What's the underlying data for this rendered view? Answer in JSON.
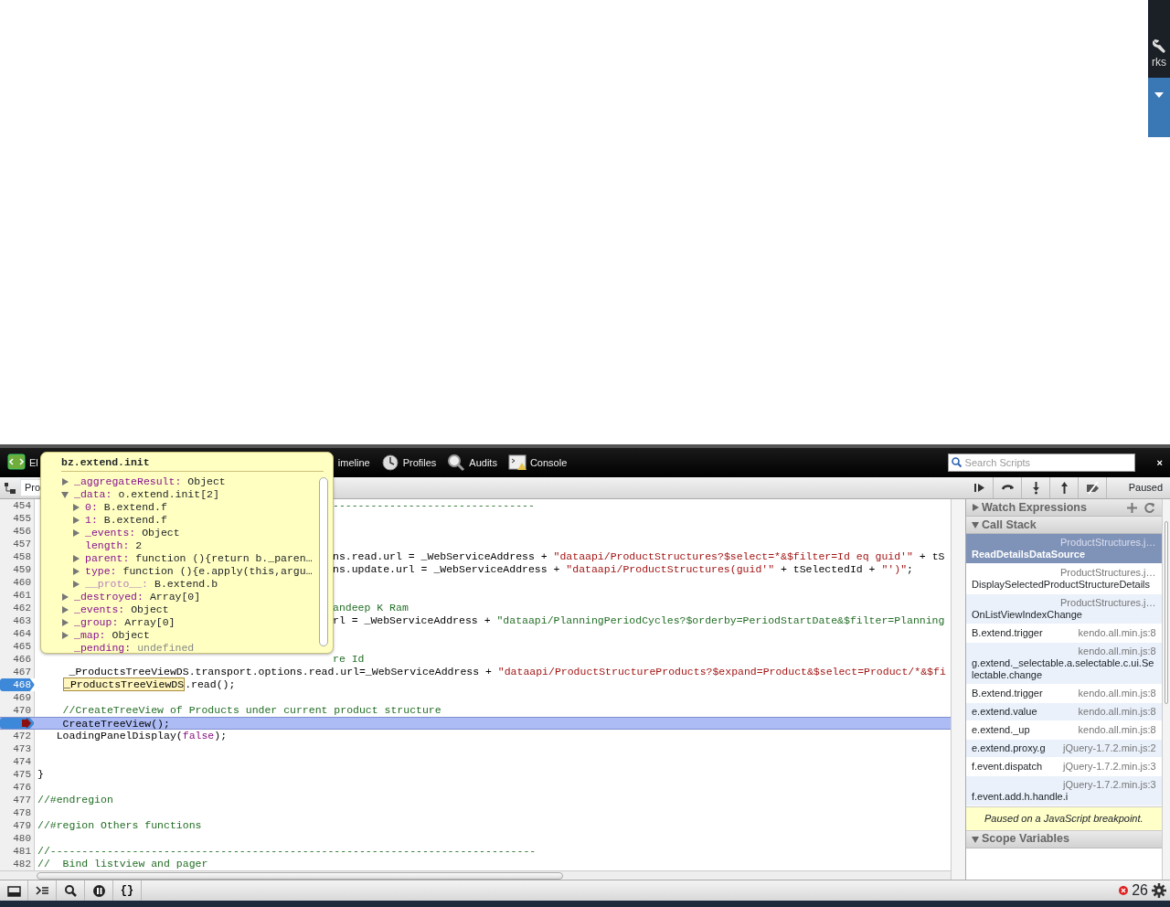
{
  "browser_edge": {
    "label": "rks"
  },
  "devtools": {
    "tabs": [
      {
        "label": "El"
      },
      {
        "label": "imeline"
      },
      {
        "label": "Profiles"
      },
      {
        "label": "Audits"
      },
      {
        "label": "Console"
      }
    ],
    "search": {
      "placeholder": "Search Scripts"
    },
    "close": "×",
    "script_select": "Pro",
    "status": "Paused",
    "code_lines": [
      {
        "number": "454",
        "kind": "behind_tooltip",
        "breakpoint": false,
        "current": false,
        "segments": [
          {
            "text": "--------------------------------",
            "kind": "comment"
          }
        ]
      },
      {
        "number": "455",
        "breakpoint": false,
        "current": false
      },
      {
        "number": "456",
        "breakpoint": false,
        "current": false
      },
      {
        "number": "457",
        "breakpoint": false,
        "current": false
      },
      {
        "number": "458",
        "kind": "behind_tooltip",
        "breakpoint": false,
        "current": false,
        "segments": [
          {
            "text": "ns.read.url = _WebServiceAddress + ",
            "kind": "plain"
          },
          {
            "text": "\"dataapi/ProductStructures?$select=*&$filter=Id eq guid'\"",
            "kind": "string"
          },
          {
            "text": " + tS",
            "kind": "plain"
          }
        ]
      },
      {
        "number": "459",
        "kind": "behind_tooltip",
        "breakpoint": false,
        "current": false,
        "segments": [
          {
            "text": "ns.update.url = _WebServiceAddress + ",
            "kind": "plain"
          },
          {
            "text": "\"dataapi/ProductStructures(guid'\"",
            "kind": "string"
          },
          {
            "text": " + tSelectedId + ",
            "kind": "plain"
          },
          {
            "text": "\"')\"",
            "kind": "string"
          },
          {
            "text": ";",
            "kind": "plain"
          }
        ]
      },
      {
        "number": "460",
        "breakpoint": false,
        "current": false
      },
      {
        "number": "461",
        "breakpoint": false,
        "current": false
      },
      {
        "number": "462",
        "kind": "behind_tooltip",
        "breakpoint": false,
        "current": false,
        "segments": [
          {
            "text": "andeep K Ram",
            "kind": "comment"
          }
        ]
      },
      {
        "number": "463",
        "kind": "behind_tooltip",
        "breakpoint": false,
        "current": false,
        "segments": [
          {
            "text": "rl = _WebServiceAddress + ",
            "kind": "plain"
          },
          {
            "text": "\"dataapi/PlanningPeriodCycles?$orderby=PeriodStartDate&$filter=Planning",
            "kind": "string_alt"
          }
        ]
      },
      {
        "number": "464",
        "breakpoint": false,
        "current": false
      },
      {
        "number": "465",
        "breakpoint": false,
        "current": false
      },
      {
        "number": "466",
        "kind": "behind_tooltip",
        "breakpoint": false,
        "current": false,
        "segments": [
          {
            "text": "re Id",
            "kind": "comment"
          }
        ]
      },
      {
        "number": "467",
        "kind": "full",
        "breakpoint": false,
        "current": false,
        "segments": [
          {
            "text": "     _ProductsTreeViewDS.transport.options.read.url=_WebServiceAddress + ",
            "kind": "plain"
          },
          {
            "text": "\"dataapi/ProductStructureProducts?$expand=Product&$select=Product/*&$fi",
            "kind": "string"
          }
        ]
      },
      {
        "number": "468",
        "kind": "full",
        "breakpoint": true,
        "current": false,
        "segments": [
          {
            "text": "_ProductsTreeViewDS",
            "kind": "hover"
          },
          {
            "text": ".read();",
            "kind": "plain"
          }
        ]
      },
      {
        "number": "469",
        "breakpoint": false,
        "current": false
      },
      {
        "number": "470",
        "kind": "full",
        "breakpoint": false,
        "current": false,
        "segments": [
          {
            "text": "    //CreateTreeView of Products under current product structure",
            "kind": "comment"
          }
        ]
      },
      {
        "kind": "full",
        "breakpoint": true,
        "current": true,
        "segments": [
          {
            "text": "    CreateTreeView();",
            "kind": "plain"
          }
        ]
      },
      {
        "number": "472",
        "kind": "full",
        "breakpoint": false,
        "current": false,
        "segments": [
          {
            "text": "   LoadingPanelDisplay(",
            "kind": "plain"
          },
          {
            "text": "false",
            "kind": "keyword"
          },
          {
            "text": ");",
            "kind": "plain"
          }
        ]
      },
      {
        "number": "473",
        "breakpoint": false,
        "current": false
      },
      {
        "number": "474",
        "breakpoint": false,
        "current": false
      },
      {
        "number": "475",
        "kind": "full",
        "breakpoint": false,
        "current": false,
        "segments": [
          {
            "text": "}",
            "kind": "plain"
          }
        ]
      },
      {
        "number": "476",
        "breakpoint": false,
        "current": false
      },
      {
        "number": "477",
        "kind": "full",
        "breakpoint": false,
        "current": false,
        "segments": [
          {
            "text": "//#endregion",
            "kind": "comment"
          }
        ]
      },
      {
        "number": "478",
        "breakpoint": false,
        "current": false
      },
      {
        "number": "479",
        "kind": "full",
        "breakpoint": false,
        "current": false,
        "segments": [
          {
            "text": "//#region Others functions",
            "kind": "comment"
          }
        ]
      },
      {
        "number": "480",
        "breakpoint": false,
        "current": false
      },
      {
        "number": "481",
        "kind": "full",
        "breakpoint": false,
        "current": false,
        "segments": [
          {
            "text": "//-----------------------------------------------------------------------------",
            "kind": "comment"
          }
        ]
      },
      {
        "number": "482",
        "kind": "full",
        "breakpoint": false,
        "current": false,
        "segments": [
          {
            "text": "//  Bind listview and pager",
            "kind": "comment"
          }
        ]
      }
    ],
    "tooltip": {
      "title": "bz.extend.init",
      "properties": [
        {
          "name": "_aggregateResult:",
          "value": "Object",
          "kind": "value",
          "expandable": true,
          "expanded": false
        },
        {
          "name": "_data:",
          "value": "o.extend.init[2]",
          "kind": "value",
          "expandable": true,
          "expanded": true,
          "children": [
            {
              "name": "0:",
              "value": "B.extend.f",
              "kind": "value",
              "expandable": true,
              "expanded": false
            },
            {
              "name": "1:",
              "value": "B.extend.f",
              "kind": "value",
              "expandable": true,
              "expanded": false
            },
            {
              "name": "_events:",
              "value": "Object",
              "kind": "value",
              "expandable": true,
              "expanded": false
            },
            {
              "name": "length:",
              "value": "2",
              "kind": "value",
              "expandable": false
            },
            {
              "name": "parent:",
              "value": "function (){return b._paren…",
              "kind": "value",
              "expandable": true,
              "expanded": false
            },
            {
              "name": "type:",
              "value": "function (){e.apply(this,argu…",
              "kind": "value",
              "expandable": true,
              "expanded": false
            },
            {
              "name": "__proto__:",
              "value": "B.extend.b",
              "kind": "proto",
              "expandable": true,
              "expanded": false
            }
          ]
        },
        {
          "name": "_destroyed:",
          "value": "Array[0]",
          "kind": "value",
          "expandable": true,
          "expanded": false
        },
        {
          "name": "_events:",
          "value": "Object",
          "kind": "value",
          "expandable": true,
          "expanded": false
        },
        {
          "name": "_group:",
          "value": "Array[0]",
          "kind": "value",
          "expandable": true,
          "expanded": false
        },
        {
          "name": "_map:",
          "value": "Object",
          "kind": "value",
          "expandable": true,
          "expanded": false
        },
        {
          "name": "_pending:",
          "value": "undefined",
          "kind": "undefined",
          "expandable": false
        }
      ]
    },
    "watch_expressions": {
      "title": "Watch Expressions",
      "expanded": false
    },
    "call_stack": {
      "title": "Call Stack",
      "expanded": true,
      "frames": [
        {
          "function": "ReadDetailsDataSource",
          "file": "ProductStructures.j…",
          "selected": true
        },
        {
          "function": "DisplaySelectedProductStructureDetails",
          "file": "ProductStructures.j…",
          "selected": false
        },
        {
          "function": "OnListViewIndexChange",
          "file": "ProductStructures.j…",
          "selected": false
        },
        {
          "function": "B.extend.trigger",
          "file": "kendo.all.min.js:8",
          "selected": false
        },
        {
          "function": "g.extend._selectable.a.selectable.c.ui.Selectable.change",
          "file": "kendo.all.min.js:8",
          "selected": false
        },
        {
          "function": "B.extend.trigger",
          "file": "kendo.all.min.js:8",
          "selected": false
        },
        {
          "function": "e.extend.value",
          "file": "kendo.all.min.js:8",
          "selected": false
        },
        {
          "function": "e.extend._up",
          "file": "kendo.all.min.js:8",
          "selected": false
        },
        {
          "function": "e.extend.proxy.g",
          "file": "jQuery-1.7.2.min.js:2",
          "selected": false
        },
        {
          "function": "f.event.dispatch",
          "file": "jQuery-1.7.2.min.js:3",
          "selected": false
        },
        {
          "function": "f.event.add.h.handle.i",
          "file": "jQuery-1.7.2.min.js:3",
          "selected": false
        }
      ]
    },
    "paused_message": "Paused on a JavaScript breakpoint.",
    "scope_variables": {
      "title": "Scope Variables",
      "expanded": true
    },
    "format_button": "{}",
    "error_count": "26"
  }
}
